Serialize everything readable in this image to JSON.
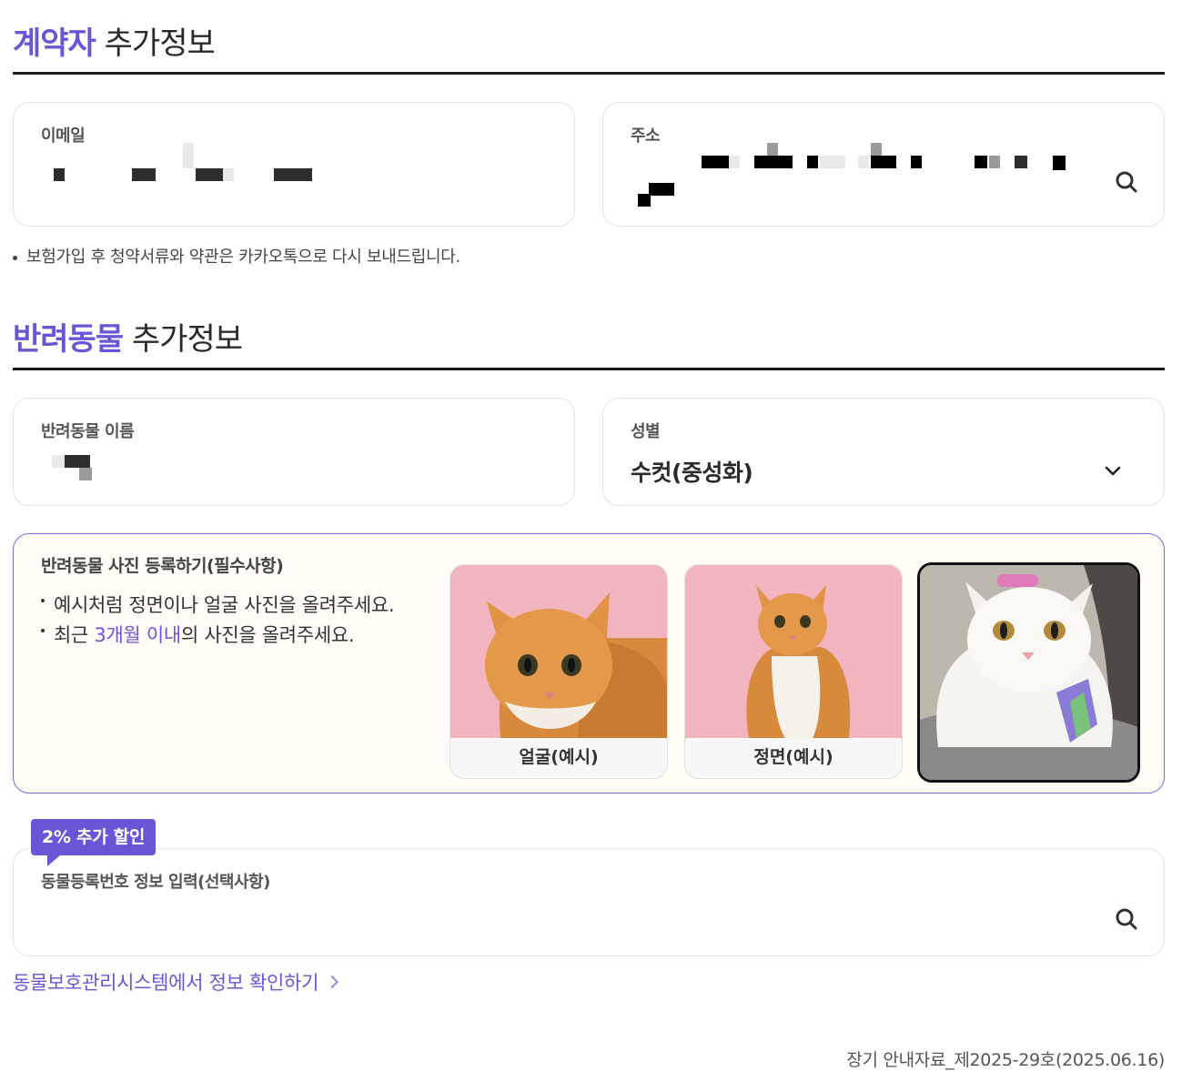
{
  "contractor_section": {
    "title_accent": "계약자",
    "title_rest": " 추가정보"
  },
  "email": {
    "label": "이메일"
  },
  "address": {
    "label": "주소"
  },
  "notice": "보험가입 후 청약서류와 약관은 카카오톡으로 다시 보내드립니다.",
  "pet_section": {
    "title_accent": "반려동물",
    "title_rest": " 추가정보"
  },
  "pet_name": {
    "label": "반려동물 이름"
  },
  "gender": {
    "label": "성별",
    "selected": "수컷(중성화)"
  },
  "photo": {
    "label": "반려동물 사진 등록하기(필수사항)",
    "bullet1": "예시처럼 정면이나 얼굴 사진을 올려주세요.",
    "bullet2_pre": "최근 ",
    "bullet2_hl": "3개월 이내",
    "bullet2_post": "의 사진을 올려주세요.",
    "example_face": "얼굴(예시)",
    "example_front": "정면(예시)"
  },
  "registration": {
    "badge": "2% 추가 할인",
    "label": "동물등록번호 정보 입력(선택사항)"
  },
  "link_text": "동물보호관리시스템에서 정보 확인하기",
  "footer": "장기 안내자료_제2025-29호(2025.06.16)",
  "colors": {
    "accent": "#6b55d6",
    "photo_bg": "#f2b5bf"
  }
}
